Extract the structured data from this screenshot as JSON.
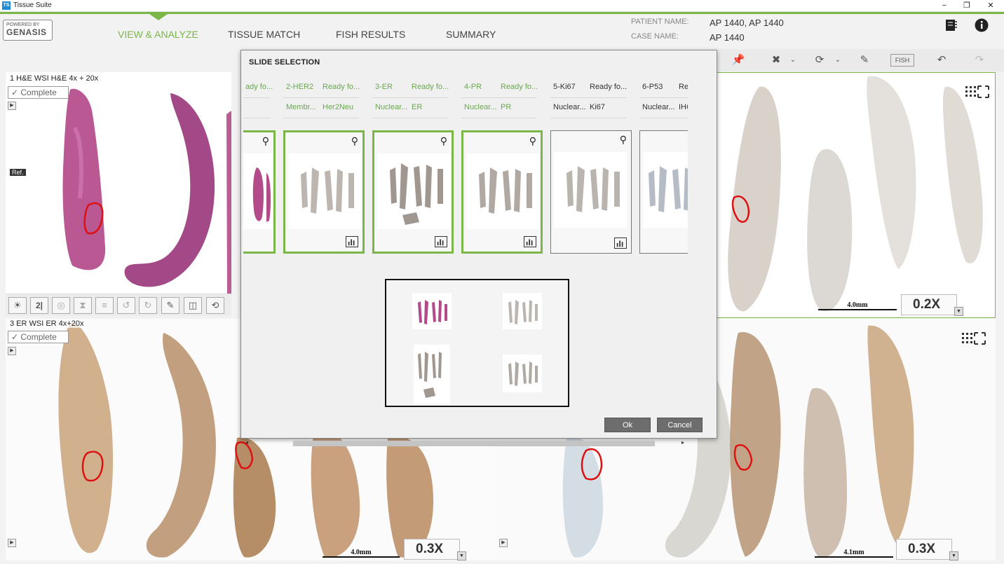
{
  "window": {
    "icon_text": "TS",
    "title": "Tissue Suite",
    "controls": [
      "−",
      "❐",
      "✕"
    ]
  },
  "logo": {
    "line1": "POWERED BY",
    "line2": "GENASIS"
  },
  "nav": {
    "tabs": [
      "VIEW & ANALYZE",
      "TISSUE MATCH",
      "FISH RESULTS",
      "SUMMARY"
    ],
    "active": 0
  },
  "patient": {
    "name_label": "PATIENT NAME:",
    "name_value": "AP 1440, AP 1440",
    "case_label": "CASE NAME:",
    "case_value": "AP 1440"
  },
  "tiles": {
    "top_left": {
      "label": "1 H&E WSI H&E 4x + 20x",
      "status": "Complete",
      "ref_tag": "Ref."
    },
    "bottom_left": {
      "label": "3 ER WSI ER 4x+20x",
      "status": "Complete",
      "scale": "4.0mm",
      "zoom": "0.3X"
    },
    "top_right": {
      "scale": "4.0mm",
      "zoom": "0.2X"
    },
    "bottom_right": {
      "scale": "4.1mm",
      "zoom": "0.3X"
    }
  },
  "toolbar": {
    "icons": [
      "brightness-icon",
      "2d-icon",
      "overlay-icon",
      "mirror-icon",
      "align-icon",
      "rotate-icon",
      "rotate-cancel-icon",
      "note-icon",
      "split-icon",
      "reset-icon"
    ]
  },
  "dialog": {
    "title": "SLIDE SELECTION",
    "slides": [
      {
        "name": "",
        "status": "ady fo...",
        "type": "",
        "marker": "",
        "selected": true
      },
      {
        "name": "2-HER2",
        "status": "Ready fo...",
        "type": "Membr...",
        "marker": "Her2Neu",
        "selected": true
      },
      {
        "name": "3-ER",
        "status": "Ready fo...",
        "type": "Nuclear...",
        "marker": "ER",
        "selected": true
      },
      {
        "name": "4-PR",
        "status": "Ready fo...",
        "type": "Nuclear...",
        "marker": "PR",
        "selected": true
      },
      {
        "name": "5-Ki67",
        "status": "Ready fo...",
        "type": "Nuclear...",
        "marker": "Ki67",
        "selected": false
      },
      {
        "name": "6-P53",
        "status": "Rea",
        "type": "Nuclear...",
        "marker": "IHC",
        "selected": false
      }
    ],
    "ok_label": "Ok",
    "cancel_label": "Cancel"
  },
  "colors": {
    "accent": "#7ab648",
    "he_stain": "#b34a8a",
    "er_stain": "#9a6b3d",
    "roi": "#dd1111"
  }
}
